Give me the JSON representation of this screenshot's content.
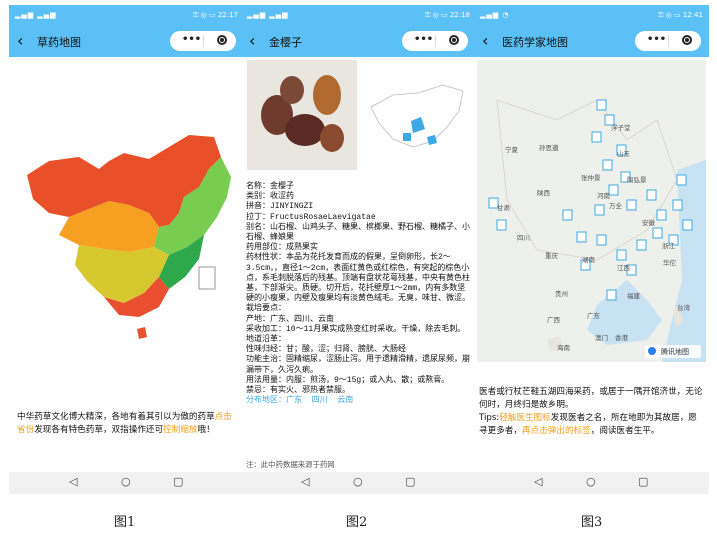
{
  "phones": [
    {
      "status_time": "22:17",
      "title": "草药地图"
    },
    {
      "status_time": "22:18",
      "title": "金樱子"
    },
    {
      "status_time": "12:41",
      "title": "医药学家地图"
    }
  ],
  "captions": [
    "图1",
    "图2",
    "图3"
  ],
  "screen1": {
    "desc_a": "中华药草文化博大精深，各地有着其引以为傲的药草",
    "desc_hl1": "点击省份",
    "desc_b": "发现各有特色药草，双指操作还可",
    "desc_hl2": "控制缩放",
    "desc_c": "哦！"
  },
  "screen2": {
    "lines": [
      "名称：金樱子",
      "类别：收涩药",
      "拼音：JINYINGZI",
      "拉丁：FructusRosaeLaevigatae",
      "别名：山石榴、山鸡头子、糖果、槟榔果、野石榴、糖橘子、小石榴、蜂娘果",
      "药用部位：成熟果实",
      "药材性状：本品为花托发育而成的假果，呈倒卵形，长2～3.5cm，，直径1～2cm，表面红黄色或红棕色，有突起的棕色小点，系毛刺脱落后的残基。顶端有盘状花萼残基，中央有黄色柱基，下部渐尖。质硬。切开后，花托壁厚1～2mm，内有多数坚硬的小瘦果，内壁及瘦果均有淡黄色绒毛。无臭，味甘、微涩。",
      "栽培要点：",
      "产地：广东、四川、云南",
      "采收加工：10～11月果实成熟变红时采收。干燥，除去毛刺。",
      "地道沿革：",
      "性味归经：甘；酸，涩；归肾、膀胱、大肠经",
      "功能主治：固精缩尿，涩肠止泻。用于遗精滑精，遗尿尿频，崩漏带下，久泻久痢。",
      "用法用量：内服：煎汤，9～15g；或入丸、散；或熬膏。",
      "禁忌：有实火、邪热者禁服。"
    ],
    "distribution": "分布地区：广东  四川  云南",
    "note": "注：此中药数据来源于药网"
  },
  "screen3": {
    "desc_a": "医者或行杖芒鞋五湖四海采药，或居于一隅开馆济世，无论何时，月终归是故乡明。",
    "tips_label": "Tips:",
    "tips_hl1": "轻触医生图标",
    "tips_b": "发现医者之名，所在地即为其故居，愿寻更多者，",
    "tips_hl2": "再点击弹出的标签",
    "tips_c": "，阅读医者生平。",
    "map_brand": "腾讯地图",
    "map_labels": [
      "宁夏",
      "孙思邈",
      "陕西",
      "甘肃",
      "四川",
      "重庆",
      "贵州",
      "广西",
      "广东",
      "湖南",
      "江西",
      "福建",
      "浙江",
      "安徽",
      "河南",
      "山东",
      "海南",
      "澳门",
      "香港",
      "台湾",
      "浮子堂",
      "张仲景",
      "陶弘景",
      "万全",
      "华佗"
    ]
  },
  "colors": {
    "accent": "#5bc0f6",
    "highlight": "#f0a020",
    "link": "#3aa9e5"
  }
}
